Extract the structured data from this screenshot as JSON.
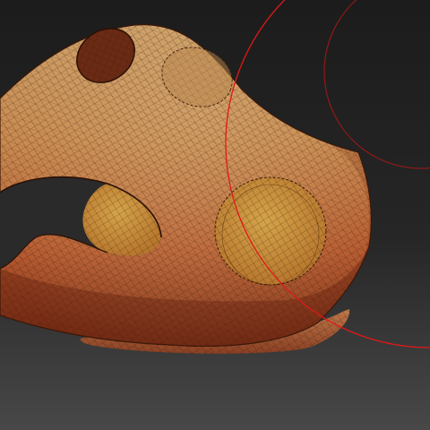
{
  "app": {
    "viewport": {
      "background_top": "#1c1c1c",
      "background_bottom": "#4a4a4a"
    },
    "model": {
      "surface_light": "#c89a5c",
      "surface_mid": "#c0703c",
      "surface_dark": "#6a2412",
      "wire_color": "#3a1a08",
      "hole_fill": "#c89a3c"
    },
    "brush": {
      "outer_ring_color": "#e01818",
      "inner_ring_color": "#b01818",
      "icon": "brush-cursor-icon"
    }
  }
}
